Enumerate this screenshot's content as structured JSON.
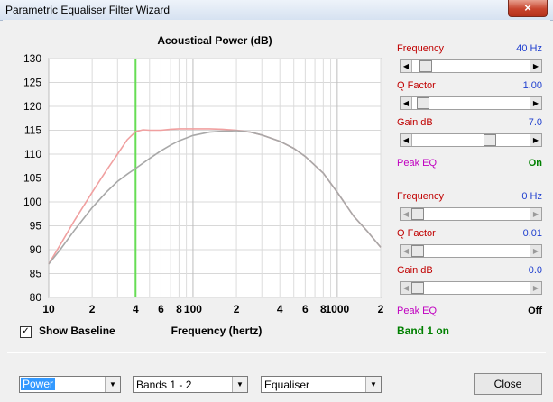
{
  "window": {
    "title": "Parametric Equaliser Filter Wizard",
    "close_glyph": "×"
  },
  "chart_data": {
    "type": "line",
    "title": "Acoustical Power (dB)",
    "xlabel": "Frequency (hertz)",
    "ylabel": "",
    "xscale": "log",
    "xlim": [
      10,
      2000
    ],
    "ylim": [
      80,
      130
    ],
    "y_ticks": [
      80,
      85,
      90,
      95,
      100,
      105,
      110,
      115,
      120,
      125,
      130
    ],
    "x_tick_labels": [
      {
        "x": 10,
        "label": "10"
      },
      {
        "x": 20,
        "label": "2"
      },
      {
        "x": 40,
        "label": "4"
      },
      {
        "x": 60,
        "label": "6"
      },
      {
        "x": 80,
        "label": "8"
      },
      {
        "x": 100,
        "label": "100"
      },
      {
        "x": 200,
        "label": "2"
      },
      {
        "x": 400,
        "label": "4"
      },
      {
        "x": 600,
        "label": "6"
      },
      {
        "x": 800,
        "label": "8"
      },
      {
        "x": 1000,
        "label": "1000"
      },
      {
        "x": 2000,
        "label": "2"
      }
    ],
    "marker_frequency": 40,
    "grid": true,
    "series": [
      {
        "color": "#f0a0a0",
        "x": [
          10,
          12,
          15,
          20,
          25,
          30,
          35,
          40,
          45,
          50,
          60,
          70,
          80,
          100,
          130,
          160,
          200,
          250,
          300,
          400,
          500,
          600,
          800,
          1000,
          1300,
          1600,
          2000
        ],
        "y": [
          87,
          91,
          96,
          102,
          106.5,
          110,
          113,
          114.7,
          115.1,
          115.0,
          115.0,
          115.2,
          115.3,
          115.3,
          115.3,
          115.2,
          115.0,
          114.6,
          114.0,
          112.7,
          111.2,
          109.5,
          106.0,
          102.0,
          97.0,
          94.0,
          90.5
        ]
      },
      {
        "color": "#a8a8a8",
        "x": [
          10,
          12,
          15,
          20,
          25,
          30,
          35,
          40,
          50,
          60,
          70,
          80,
          100,
          130,
          160,
          200,
          250,
          300,
          400,
          500,
          600,
          800,
          1000,
          1300,
          1600,
          2000
        ],
        "y": [
          87,
          90,
          94,
          98.8,
          102.0,
          104.3,
          105.8,
          107.0,
          109.1,
          110.7,
          111.9,
          112.8,
          113.9,
          114.6,
          114.8,
          114.9,
          114.6,
          114.0,
          112.7,
          111.2,
          109.5,
          106.0,
          102.0,
          97.0,
          94.0,
          90.5
        ]
      }
    ]
  },
  "panel": {
    "band1": {
      "frequency_label": "Frequency",
      "frequency_value": "40 Hz",
      "frequency_pos": 0.08,
      "q_label": "Q Factor",
      "q_value": "1.00",
      "q_pos": 0.05,
      "gain_label": "Gain  dB",
      "gain_value": "7.0",
      "gain_pos": 0.68,
      "peak_label": "Peak EQ",
      "peak_state": "On"
    },
    "band2": {
      "frequency_label": "Frequency",
      "frequency_value": "0 Hz",
      "frequency_pos": 0.0,
      "q_label": "Q Factor",
      "q_value": "0.01",
      "q_pos": 0.0,
      "gain_label": "Gain  dB",
      "gain_value": "0.0",
      "gain_pos": 0.0,
      "peak_label": "Peak EQ",
      "peak_state": "Off"
    },
    "band_status": "Band 1 on"
  },
  "baseline": {
    "label": "Show Baseline",
    "checked_glyph": "✓"
  },
  "controls": {
    "view_select": "Power",
    "bands_select": "Bands 1 - 2",
    "mode_select": "Equaliser",
    "dropdown_glyph": "▼",
    "close_button": "Close"
  },
  "slider_glyphs": {
    "left": "◀",
    "right": "▶"
  }
}
